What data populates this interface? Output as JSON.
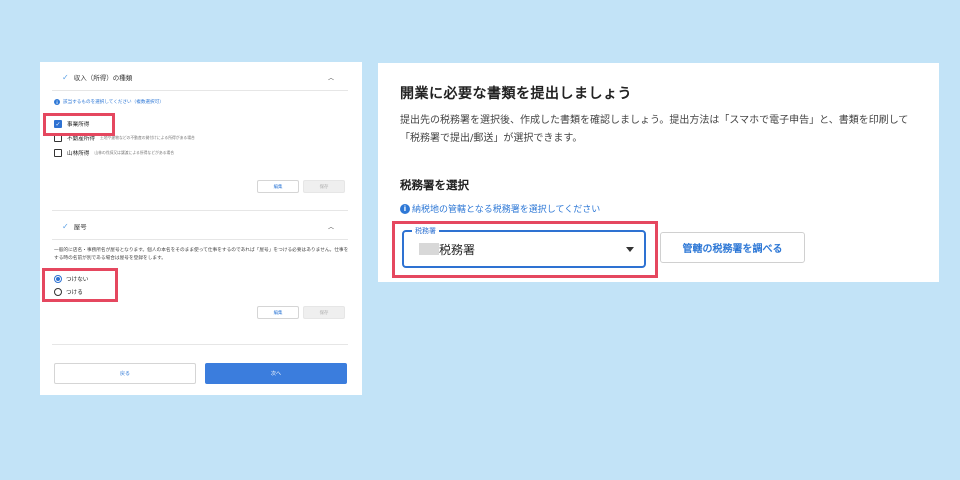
{
  "left": {
    "income_section": {
      "title": "収入（所得）の種類",
      "info": "該当するものを選択してください（複数選択可）",
      "options": [
        {
          "label": "事業所得",
          "desc": "",
          "checked": true
        },
        {
          "label": "不動産所得",
          "desc": "土地や建物などの不動産の貸付けによる所得がある場合",
          "checked": false
        },
        {
          "label": "山林所得",
          "desc": "山林の伐採又は譲渡による所得などがある場合",
          "checked": false
        }
      ],
      "edit_label": "編集",
      "save_label": "保存"
    },
    "yago_section": {
      "title": "屋号",
      "description": "一般的に店名・事務所名が屋号となります。個人の本名をそのまま使って仕事をするのであれば「屋号」をつける必要はありません。仕事をする時の名前が別である場合は屋号を登録をします。",
      "options": [
        {
          "label": "つけない",
          "selected": true
        },
        {
          "label": "つける",
          "selected": false
        }
      ],
      "edit_label": "編集",
      "save_label": "保存"
    },
    "back_label": "戻る",
    "next_label": "次へ"
  },
  "right": {
    "title": "開業に必要な書類を提出しましょう",
    "description": "提出先の税務署を選択後、作成した書類を確認しましょう。提出方法は「スマホで電子申告」と、書類を印刷して「税務署で提出/郵送」が選択できます。",
    "subheading": "税務署を選択",
    "info": "納税地の管轄となる税務署を選択してください",
    "select_label": "税務署",
    "select_value": "税務署",
    "lookup_button": "管轄の税務署を調べる"
  },
  "colors": {
    "background": "#c2e3f7",
    "highlight": "#e5475f",
    "accent": "#2e72d2"
  }
}
